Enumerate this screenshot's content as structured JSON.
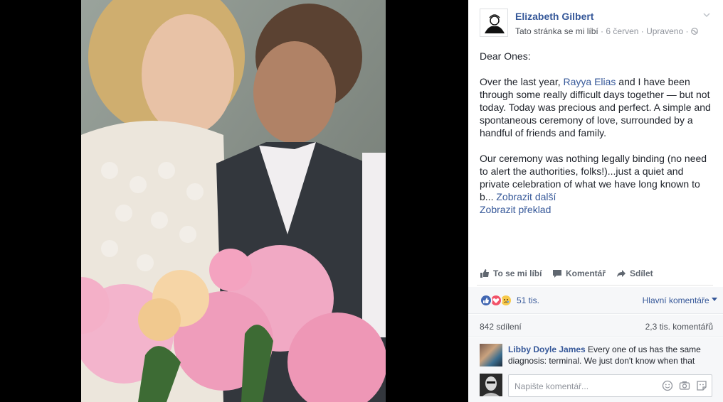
{
  "header": {
    "author": "Elizabeth Gilbert",
    "liked": "Tato stránka se mi líbí",
    "dot1": " · ",
    "date": "6 červen",
    "dot2": " · ",
    "edited": "Upraveno",
    "dot3": " · "
  },
  "post": {
    "greeting": "Dear Ones:",
    "p1_before": "Over the last year, ",
    "p1_link": "Rayya Elias",
    "p1_after": " and I have been through some really difficult days together — but not today. Today was precious and perfect. A simple and spontaneous ceremony of love, surrounded by a handful of friends and family.",
    "p2": "Our ceremony was nothing legally binding (no need to alert the authorities, folks!)...just a quiet and private celebration of what we have long known to b...",
    "see_more": " Zobrazit další",
    "translate": "Zobrazit překlad"
  },
  "actions": {
    "like": "To se mi líbí",
    "comment": "Komentář",
    "share": "Sdílet"
  },
  "reactions": {
    "count": "51 tis.",
    "sort": "Hlavní komentáře"
  },
  "stats": {
    "shares": "842 sdílení",
    "comments": "2,3 tis. komentářů"
  },
  "comment": {
    "name": "Libby Doyle James",
    "text": " Every one of us has the same diagnosis: terminal. We just don't know when that"
  },
  "composer": {
    "placeholder": "Napište komentář..."
  },
  "colors": {
    "link": "#365899",
    "like_blue": "#4267b2",
    "love_red": "#f25268",
    "sad_yellow": "#f7c94b"
  }
}
